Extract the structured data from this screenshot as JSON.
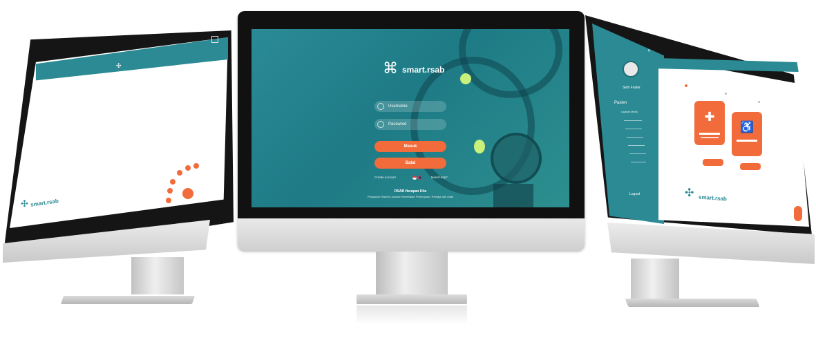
{
  "center": {
    "logo_text": "smart.rsab",
    "username_placeholder": "Username",
    "password_placeholder": "Password",
    "login_button": "Masuk",
    "reset_button": "Batal",
    "create_account_link": "Create Account",
    "need_help_link": "Need Help?",
    "footer_title": "RSAB Harapan Kita",
    "footer_subtitle": "Pelayanan Sistem Layanan Kesehatan Perempuan, Remaja dan Anak",
    "flag_id": "id-flag",
    "flag_en": "gb-flag"
  },
  "left": {
    "logo_text": "smart.rsab"
  },
  "right": {
    "user_name": "Seth Foster",
    "menu_title": "Pasien",
    "menu_items": [
      "Layanan Medis",
      "",
      "",
      "",
      "",
      "",
      ""
    ],
    "logout_label": "Logout",
    "logo_text": "smart.rsab",
    "card_buttons": [
      "",
      ""
    ]
  },
  "colors": {
    "brand_teal": "#2b8a93",
    "accent_orange": "#f26b3a",
    "highlight_green": "#c8f07a"
  }
}
